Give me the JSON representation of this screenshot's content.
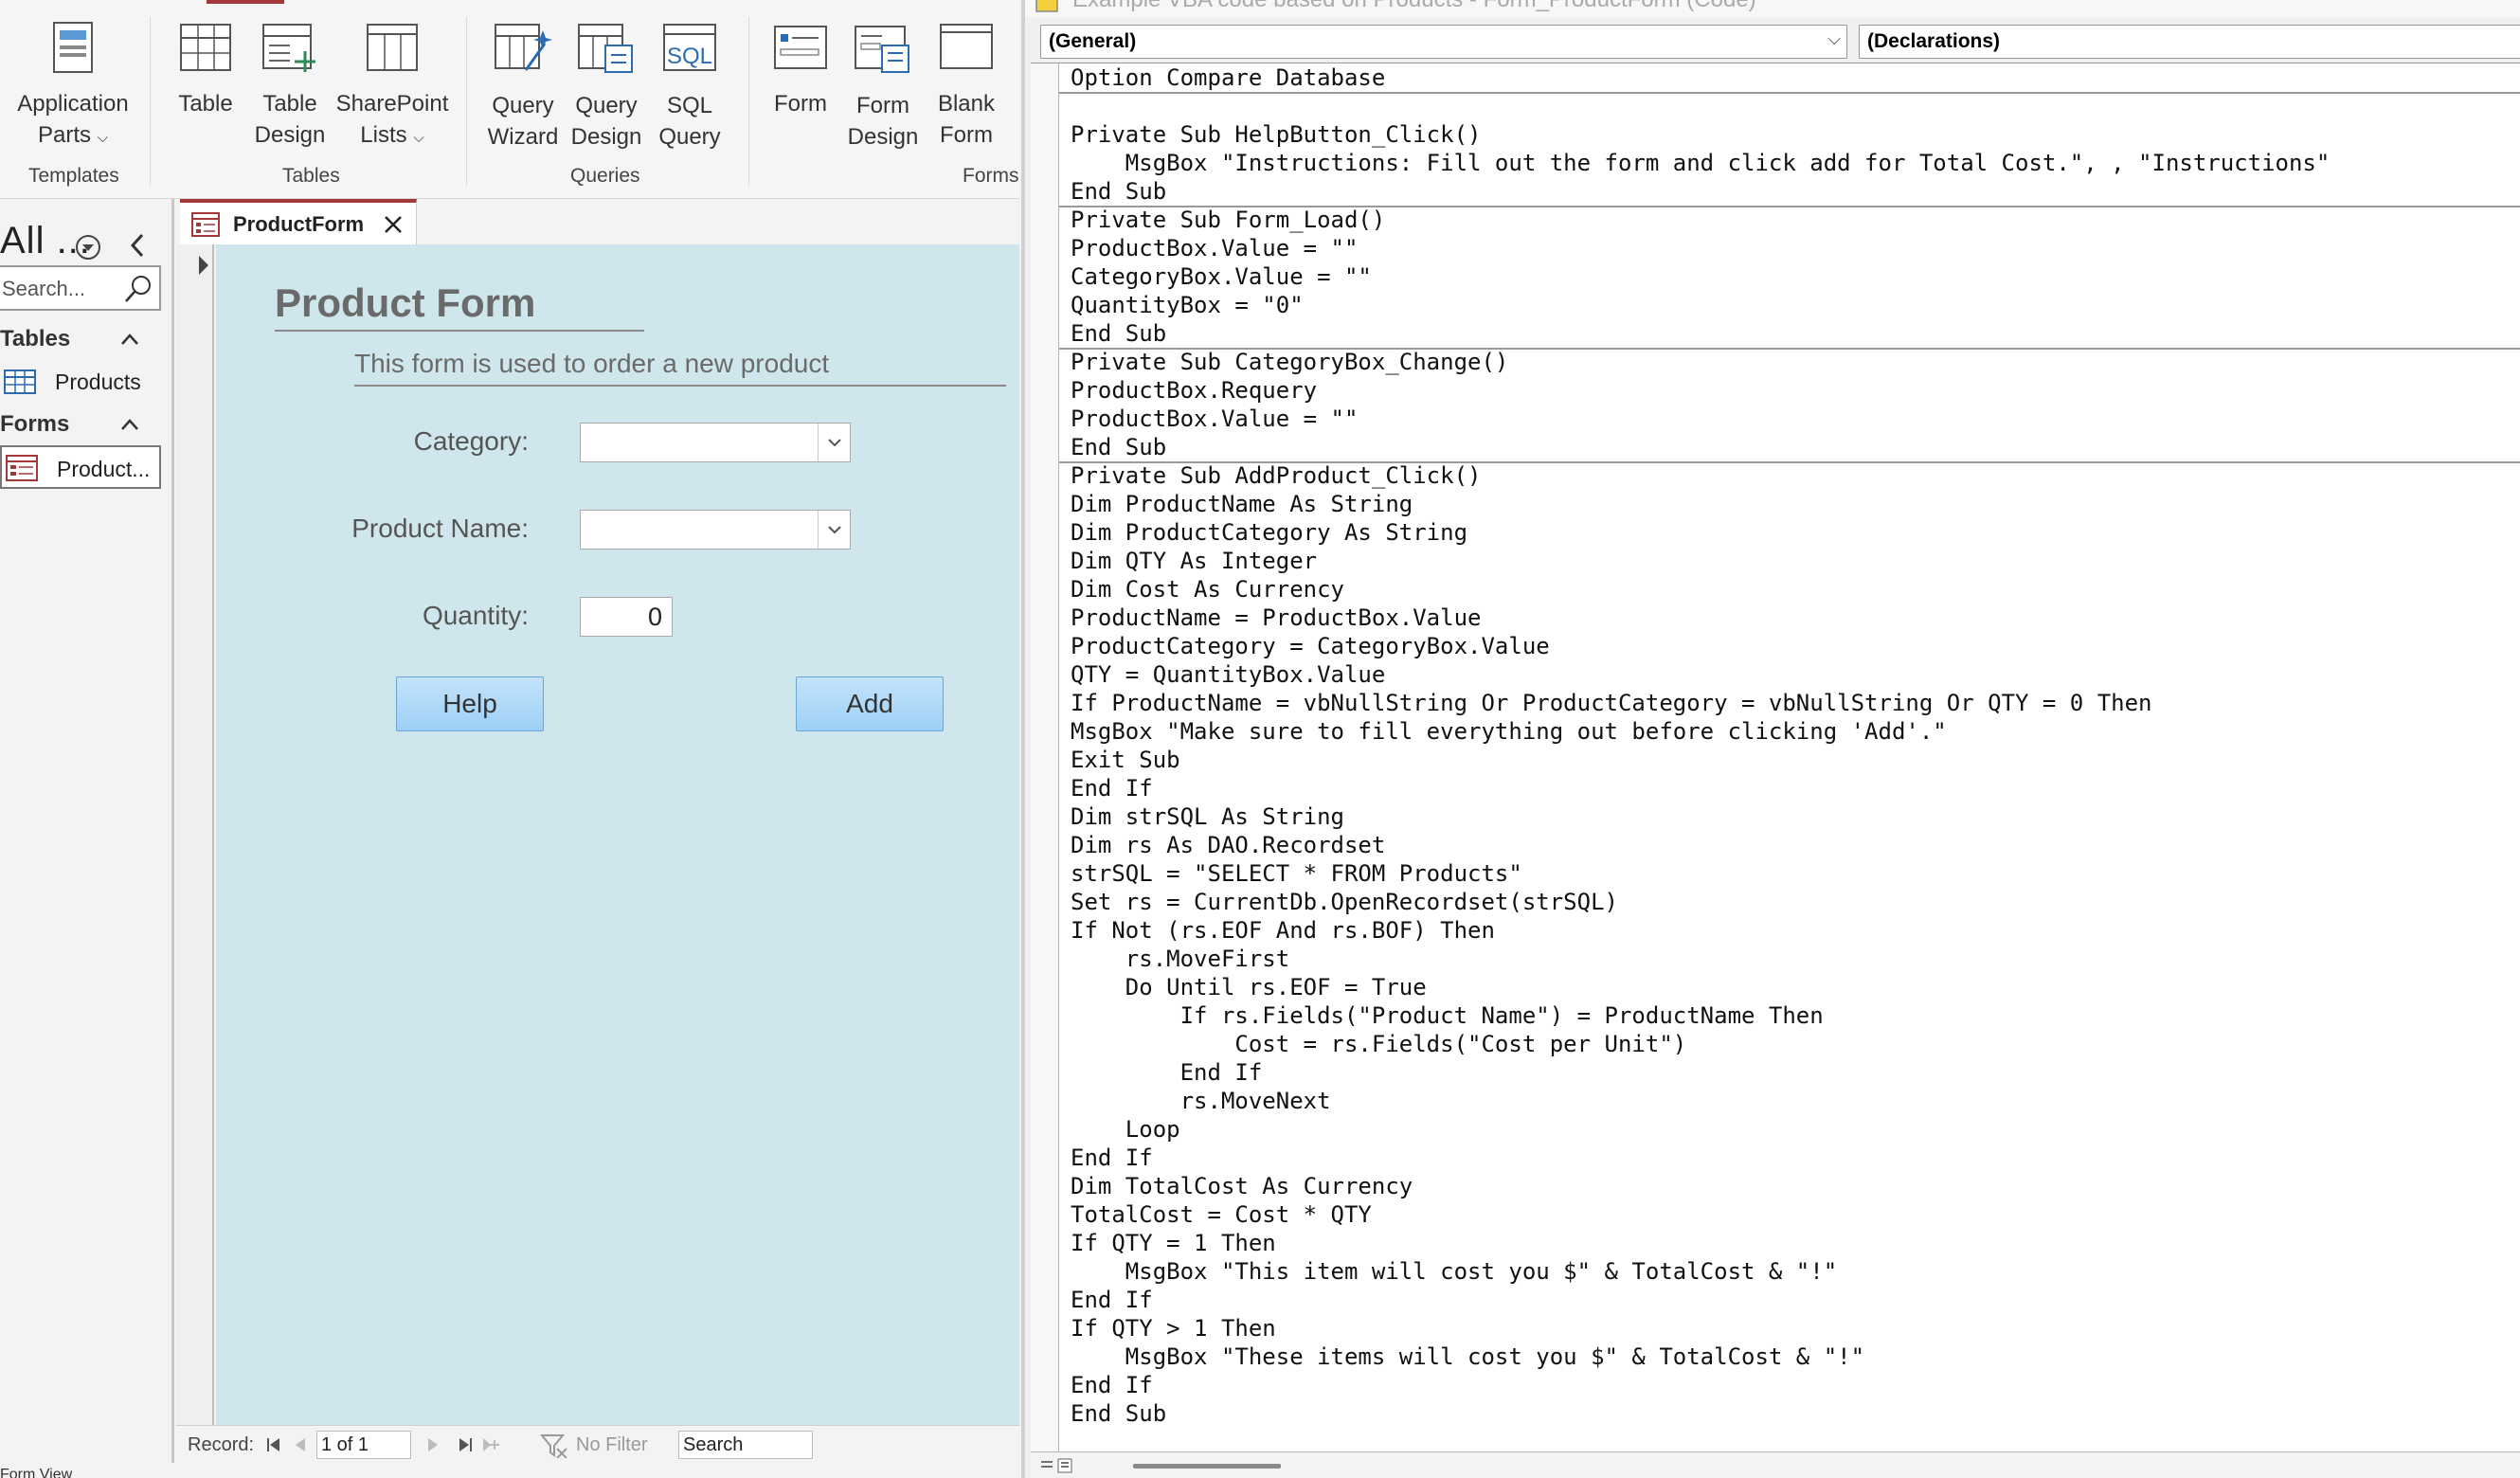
{
  "ribbon": {
    "groups": {
      "templates": "Templates",
      "tables": "Tables",
      "queries": "Queries",
      "forms": "Forms"
    },
    "buttons": {
      "app_parts": [
        "Application",
        "Parts"
      ],
      "table": [
        "Table"
      ],
      "table_design": [
        "Table",
        "Design"
      ],
      "sharepoint": [
        "SharePoint",
        "Lists"
      ],
      "query_wizard": [
        "Query",
        "Wizard"
      ],
      "query_design": [
        "Query",
        "Design"
      ],
      "sql_query": [
        "SQL",
        "Query"
      ],
      "form": [
        "Form"
      ],
      "form_design": [
        "Form",
        "Design"
      ],
      "blank_form": [
        "Blank",
        "Form"
      ]
    },
    "sql_icon_text": "SQL"
  },
  "nav": {
    "header": "All ...",
    "search_placeholder": "Search...",
    "sections": [
      {
        "label": "Tables",
        "items": [
          "Products"
        ]
      },
      {
        "label": "Forms",
        "items": [
          "Product..."
        ]
      }
    ]
  },
  "document": {
    "tab_label": "ProductForm",
    "form": {
      "title": "Product Form",
      "subtitle": "This form is used to order a new product",
      "category_label": "Category:",
      "product_label": "Product Name:",
      "quantity_label": "Quantity:",
      "quantity_value": "0",
      "help_button": "Help",
      "add_button": "Add"
    }
  },
  "record_bar": {
    "record_label": "Record:",
    "record_value": "1 of 1",
    "no_filter": "No Filter",
    "search": "Search"
  },
  "status_bar": {
    "text": "Form View"
  },
  "code_window": {
    "title": "Example VBA code based on Products - Form_ProductForm (Code)",
    "object_combo": "(General)",
    "procedure_combo": "(Declarations)",
    "lines": [
      "Option Compare Database",
      "",
      "Private Sub HelpButton_Click()",
      "    MsgBox \"Instructions: Fill out the form and click add for Total Cost.\", , \"Instructions\"",
      "End Sub",
      "Private Sub Form_Load()",
      "ProductBox.Value = \"\"",
      "CategoryBox.Value = \"\"",
      "QuantityBox = \"0\"",
      "End Sub",
      "Private Sub CategoryBox_Change()",
      "ProductBox.Requery",
      "ProductBox.Value = \"\"",
      "End Sub",
      "Private Sub AddProduct_Click()",
      "Dim ProductName As String",
      "Dim ProductCategory As String",
      "Dim QTY As Integer",
      "Dim Cost As Currency",
      "ProductName = ProductBox.Value",
      "ProductCategory = CategoryBox.Value",
      "QTY = QuantityBox.Value",
      "If ProductName = vbNullString Or ProductCategory = vbNullString Or QTY = 0 Then",
      "MsgBox \"Make sure to fill everything out before clicking 'Add'.\"",
      "Exit Sub",
      "End If",
      "Dim strSQL As String",
      "Dim rs As DAO.Recordset",
      "strSQL = \"SELECT * FROM Products\"",
      "Set rs = CurrentDb.OpenRecordset(strSQL)",
      "If Not (rs.EOF And rs.BOF) Then",
      "    rs.MoveFirst",
      "    Do Until rs.EOF = True",
      "        If rs.Fields(\"Product Name\") = ProductName Then",
      "            Cost = rs.Fields(\"Cost per Unit\")",
      "        End If",
      "        rs.MoveNext",
      "    Loop",
      "End If",
      "Dim TotalCost As Currency",
      "TotalCost = Cost * QTY",
      "If QTY = 1 Then",
      "    MsgBox \"This item will cost you $\" & TotalCost & \"!\"",
      "End If",
      "If QTY > 1 Then",
      "    MsgBox \"These items will cost you $\" & TotalCost & \"!\"",
      "End If",
      "End Sub"
    ]
  },
  "colors": {
    "access_accent": "#a4373a",
    "form_background": "#cfe7ec",
    "button_fill": "#9dd0f6"
  }
}
